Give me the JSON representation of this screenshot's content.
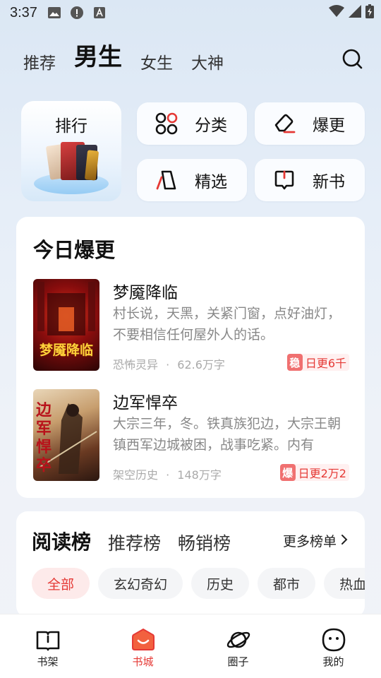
{
  "status_bar": {
    "time": "3:37"
  },
  "top_tabs": [
    {
      "label": "推荐"
    },
    {
      "label": "男生"
    },
    {
      "label": "女生"
    },
    {
      "label": "大神"
    }
  ],
  "quick_entries": {
    "rank": "排行",
    "category": "分类",
    "update": "爆更",
    "selected": "精选",
    "new_books": "新书"
  },
  "today_update": {
    "title": "今日爆更",
    "books": [
      {
        "title": "梦魇降临",
        "cover_text": "梦魇降临",
        "description": "村长说，天黑，关紧门窗，点好油灯，不要相信任何屋外人的话。",
        "genre": "恐怖灵异",
        "separator": "·",
        "words": "62.6万字",
        "badge_mark": "稳",
        "badge_text": "日更6千"
      },
      {
        "title": "边军悍卒",
        "cover_text": "边军悍卒",
        "description": "大宗三年，冬。铁真族犯边，大宗王朝镇西军边城被困，战事吃紧。内有",
        "genre": "架空历史",
        "separator": "·",
        "words": "148万字",
        "badge_mark": "爆",
        "badge_text": "日更2万2"
      }
    ]
  },
  "rankings": {
    "tabs": [
      {
        "label": "阅读榜"
      },
      {
        "label": "推荐榜"
      },
      {
        "label": "畅销榜"
      }
    ],
    "more": "更多榜单",
    "chips": [
      "全部",
      "玄幻奇幻",
      "历史",
      "都市",
      "热血"
    ]
  },
  "bottom_nav": [
    {
      "label": "书架"
    },
    {
      "label": "书城"
    },
    {
      "label": "圈子"
    },
    {
      "label": "我的"
    }
  ],
  "colors": {
    "accent": "#e53935",
    "card_bg": "#ffffff"
  }
}
